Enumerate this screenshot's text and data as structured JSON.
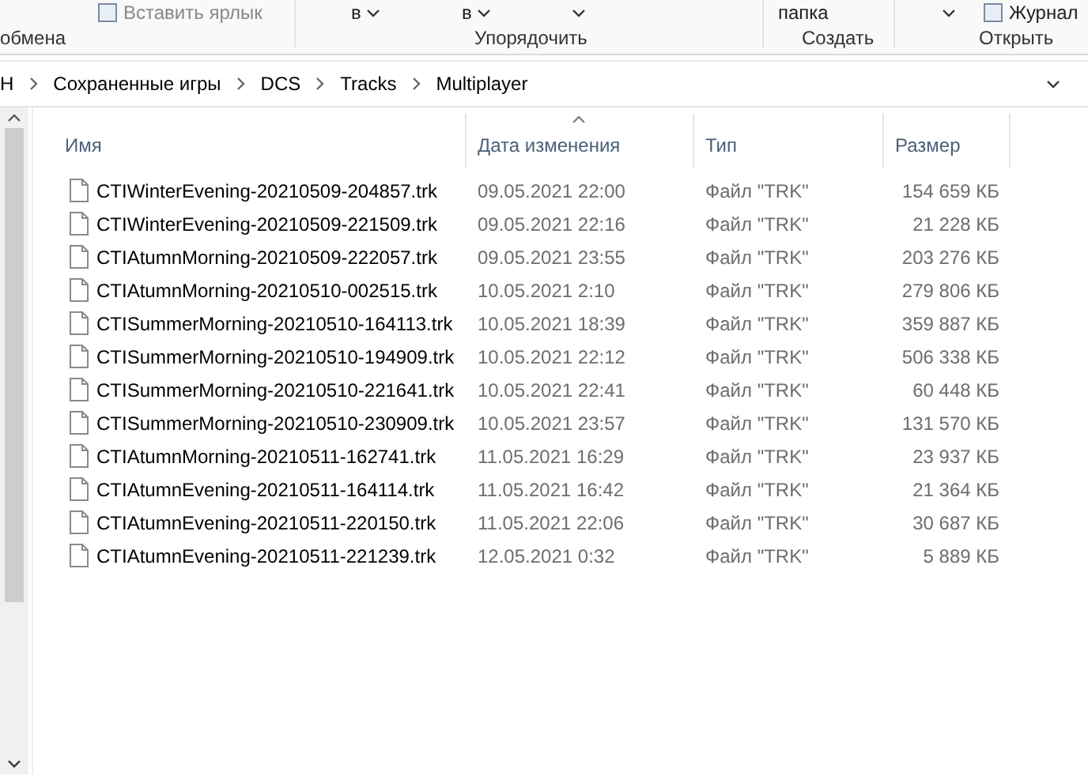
{
  "ribbon": {
    "top_items": [
      {
        "label": "Вставить ярлык",
        "kind": "icon-button"
      },
      {
        "label": "в",
        "kind": "dropdown"
      },
      {
        "label": "в",
        "kind": "dropdown"
      },
      {
        "kind": "caret"
      },
      {
        "label": "папка",
        "kind": "text"
      },
      {
        "kind": "caret"
      },
      {
        "label": "Журнал",
        "kind": "icon-button"
      }
    ],
    "groups": [
      "обмена",
      "Упорядочить",
      "Создать",
      "Открыть"
    ]
  },
  "address_bar": {
    "path": [
      "Н",
      "Сохраненные игры",
      "DCS",
      "Tracks",
      "Multiplayer"
    ]
  },
  "file_list": {
    "columns": [
      {
        "label": "Имя",
        "sorted": false
      },
      {
        "label": "Дата изменения",
        "sorted": true
      },
      {
        "label": "Тип",
        "sorted": false
      },
      {
        "label": "Размер",
        "sorted": false
      }
    ],
    "rows": [
      {
        "name": "CTIWinterEvening-20210509-204857.trk",
        "date": "09.05.2021 22:00",
        "type": "Файл \"TRK\"",
        "size": "154 659 КБ"
      },
      {
        "name": "CTIWinterEvening-20210509-221509.trk",
        "date": "09.05.2021 22:16",
        "type": "Файл \"TRK\"",
        "size": "21 228 КБ"
      },
      {
        "name": "CTIAtumnMorning-20210509-222057.trk",
        "date": "09.05.2021 23:55",
        "type": "Файл \"TRK\"",
        "size": "203 276 КБ"
      },
      {
        "name": "CTIAtumnMorning-20210510-002515.trk",
        "date": "10.05.2021 2:10",
        "type": "Файл \"TRK\"",
        "size": "279 806 КБ"
      },
      {
        "name": "CTISummerMorning-20210510-164113.trk",
        "date": "10.05.2021 18:39",
        "type": "Файл \"TRK\"",
        "size": "359 887 КБ"
      },
      {
        "name": "CTISummerMorning-20210510-194909.trk",
        "date": "10.05.2021 22:12",
        "type": "Файл \"TRK\"",
        "size": "506 338 КБ"
      },
      {
        "name": "CTISummerMorning-20210510-221641.trk",
        "date": "10.05.2021 22:41",
        "type": "Файл \"TRK\"",
        "size": "60 448 КБ"
      },
      {
        "name": "CTISummerMorning-20210510-230909.trk",
        "date": "10.05.2021 23:57",
        "type": "Файл \"TRK\"",
        "size": "131 570 КБ"
      },
      {
        "name": "CTIAtumnMorning-20210511-162741.trk",
        "date": "11.05.2021 16:29",
        "type": "Файл \"TRK\"",
        "size": "23 937 КБ"
      },
      {
        "name": "CTIAtumnEvening-20210511-164114.trk",
        "date": "11.05.2021 16:42",
        "type": "Файл \"TRK\"",
        "size": "21 364 КБ"
      },
      {
        "name": "CTIAtumnEvening-20210511-220150.trk",
        "date": "11.05.2021 22:06",
        "type": "Файл \"TRK\"",
        "size": "30 687 КБ"
      },
      {
        "name": "CTIAtumnEvening-20210511-221239.trk",
        "date": "12.05.2021 0:32",
        "type": "Файл \"TRK\"",
        "size": "5 889 КБ"
      }
    ]
  }
}
